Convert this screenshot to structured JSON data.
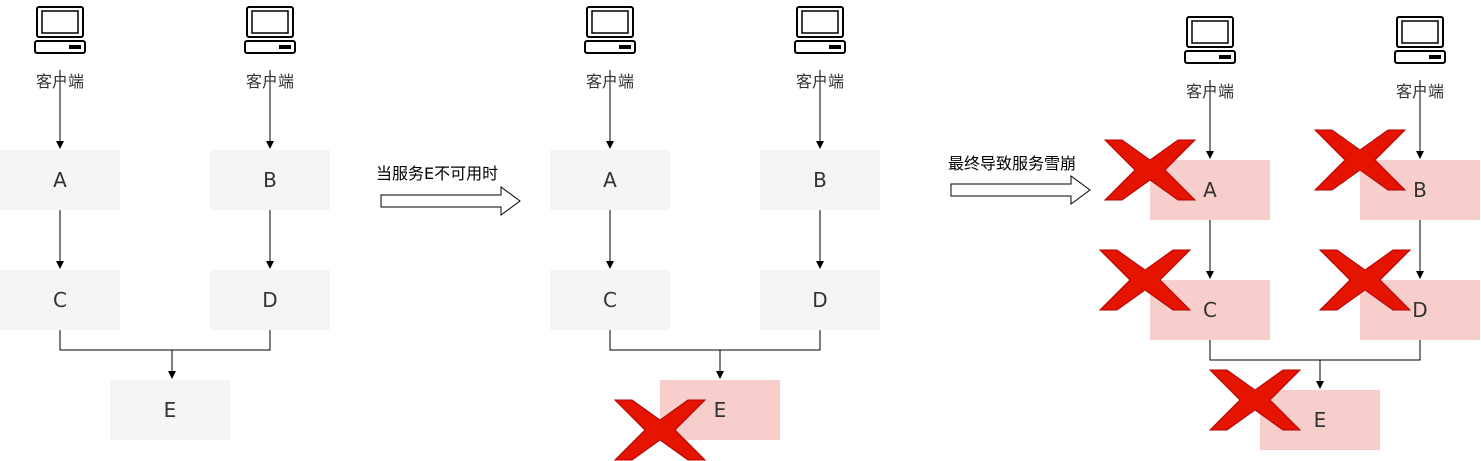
{
  "client_label": "客户端",
  "transition_1": "当服务E不可用时",
  "transition_2": "最终导致服务雪崩",
  "nodes": {
    "a": "A",
    "b": "B",
    "c": "C",
    "d": "D",
    "e": "E"
  },
  "colors": {
    "node_fill": "#f5f5f5",
    "failed_fill": "#f8cecc",
    "cross": "#e51400",
    "line": "#000000",
    "text": "#333333"
  },
  "icons": {
    "client": "computer-icon",
    "failure": "red-cross-icon",
    "transition": "right-arrow-icon"
  }
}
